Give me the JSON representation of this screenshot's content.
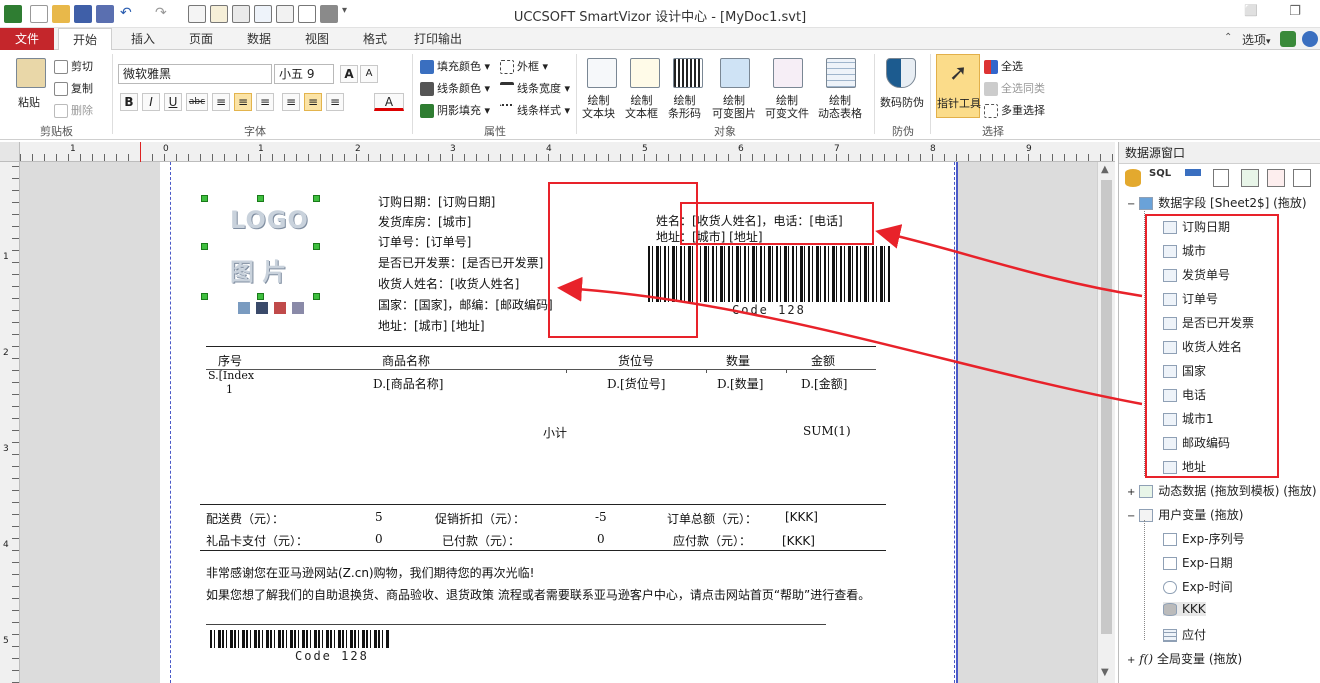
{
  "window": {
    "title": "UCCSOFT SmartVizor 设计中心 - [MyDoc1.svt]",
    "minimize_glyph": "⬜",
    "restore_glyph": "❐"
  },
  "tabs": [
    {
      "label": "文件"
    },
    {
      "label": "开始"
    },
    {
      "label": "插入"
    },
    {
      "label": "页面"
    },
    {
      "label": "数据"
    },
    {
      "label": "视图"
    },
    {
      "label": "格式"
    },
    {
      "label": "打印输出"
    }
  ],
  "tabs_right": {
    "options": "选项",
    "options_arrow": "▾"
  },
  "ribbon": {
    "clipboard": {
      "paste": "粘贴",
      "cut": "剪切",
      "copy": "复制",
      "delete": "删除",
      "group": "剪贴板"
    },
    "font": {
      "family": "微软雅黑",
      "size": "小五 9",
      "grow": "A",
      "shrink": "A",
      "bold": "B",
      "italic": "I",
      "underline": "U",
      "strike": "abc",
      "color": "A",
      "group": "字体"
    },
    "property": {
      "fill": "填充颜色",
      "line_color": "线条颜色",
      "shadow": "阴影填充",
      "border": "外框",
      "line_width": "线条宽度",
      "line_style": "线条样式",
      "group": "属性"
    },
    "object": {
      "items": [
        {
          "l1": "绘制",
          "l2": "文本块"
        },
        {
          "l1": "绘制",
          "l2": "文本框"
        },
        {
          "l1": "绘制",
          "l2": "条形码"
        },
        {
          "l1": "绘制",
          "l2": "可变图片"
        },
        {
          "l1": "绘制",
          "l2": "可变文件"
        },
        {
          "l1": "绘制",
          "l2": "动态表格"
        }
      ],
      "group": "对象"
    },
    "protect": {
      "label": "数码防伪",
      "group": "防伪"
    },
    "select": {
      "pointer": "指针工具",
      "select_all": "全选",
      "select_same": "全选同类",
      "multi": "多重选择",
      "group": "选择"
    }
  },
  "ruler": {
    "labels": [
      "1",
      "0",
      "1",
      "2",
      "3",
      "4",
      "5",
      "6",
      "7",
      "8",
      "9"
    ],
    "v_labels": [
      "1",
      "2",
      "3",
      "4",
      "5"
    ]
  },
  "doc": {
    "logo": "LOGO",
    "picture": "图 片",
    "order_fields": [
      "订购日期：[订购日期]",
      "发货库房：[城市]",
      "订单号：[订单号]",
      "是否已开发票：[是否已开发票]",
      "收货人姓名：[收货人姓名]",
      "国家：[国家]，邮编：[邮政编码]",
      "地址：[城市] [地址]"
    ],
    "recipient": [
      "姓名：[收货人姓名]，电话：[电话]",
      "地址：[城市] [地址]"
    ],
    "barcode_label": "Code 128",
    "table_headers": [
      "序号",
      "商品名称",
      "货位号",
      "数量",
      "金额"
    ],
    "index_cell": "S.[Index",
    "index_num": "1",
    "row": [
      "D.[商品名称]",
      "D.[货位号]",
      "D.[数量]",
      "D.[金额]"
    ],
    "subtotal_label": "小计",
    "subtotal_value": "SUM(1)",
    "fees": [
      {
        "label": "配送费（元）：",
        "value": "5",
        "label2": "促销折扣（元）：",
        "value2": "-5",
        "label3": "订单总额（元）：",
        "value3": "[KKK]"
      },
      {
        "label": "礼品卡支付（元）：",
        "value": "0",
        "label2": "已付款（元）：",
        "value2": "0",
        "label3": "应付款（元）：",
        "value3": "[KKK]"
      }
    ],
    "thanks": "非常感谢您在亚马逊网站(Z.cn)购物，我们期待您的再次光临!",
    "help": "如果您想了解我们的自助退换货、商品验收、退货政策 流程或者需要联系亚马逊客户中心，请点击网站首页“帮助”进行查看。",
    "barcode_label2": "Code 128"
  },
  "panel": {
    "title": "数据源窗口",
    "sql": "SQL",
    "data_fields": "数据字段 [Sheet2$] (拖放)",
    "fields": [
      "订购日期",
      "城市",
      "发货单号",
      "订单号",
      "是否已开发票",
      "收货人姓名",
      "国家",
      "电话",
      "城市1",
      "邮政编码",
      "地址"
    ],
    "dynamic": "动态数据 (拖放到模板) (拖放)",
    "user_vars": "用户变量 (拖放)",
    "vars": [
      "Exp-序列号",
      "Exp-日期",
      "Exp-时间",
      "KKK",
      "应付"
    ],
    "global": "全局变量 (拖放)",
    "expander_plus": "+",
    "expander_minus": "−",
    "fx": "f()"
  },
  "colors": {
    "accent_red": "#e8222a",
    "file_tab": "#c4262b"
  }
}
